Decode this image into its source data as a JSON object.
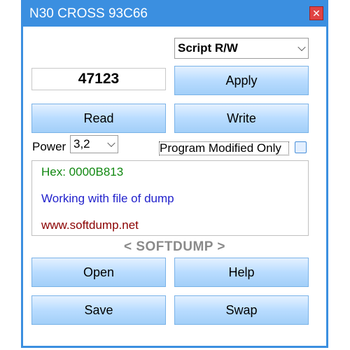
{
  "window": {
    "title": "N30 CROSS 93C66"
  },
  "mode_select": {
    "value": "Script R/W"
  },
  "value_field": {
    "value": "47123"
  },
  "buttons": {
    "apply": "Apply",
    "read": "Read",
    "write": "Write",
    "open": "Open",
    "help": "Help",
    "save": "Save",
    "swap": "Swap"
  },
  "power": {
    "label": "Power",
    "value": "3,2"
  },
  "program_modified_only": {
    "label": "Program Modified Only",
    "checked": false
  },
  "info": {
    "hex": "Hex: 0000B813",
    "status": "Working with file of dump",
    "url": "www.softdump.net"
  },
  "brand": "< SOFTDUMP >",
  "colors": {
    "title_bar": "#3b8fe0",
    "hex_text": "#118811",
    "status_text": "#2222cc",
    "url_text": "#8b0000",
    "brand_text": "#8a8a8a"
  }
}
